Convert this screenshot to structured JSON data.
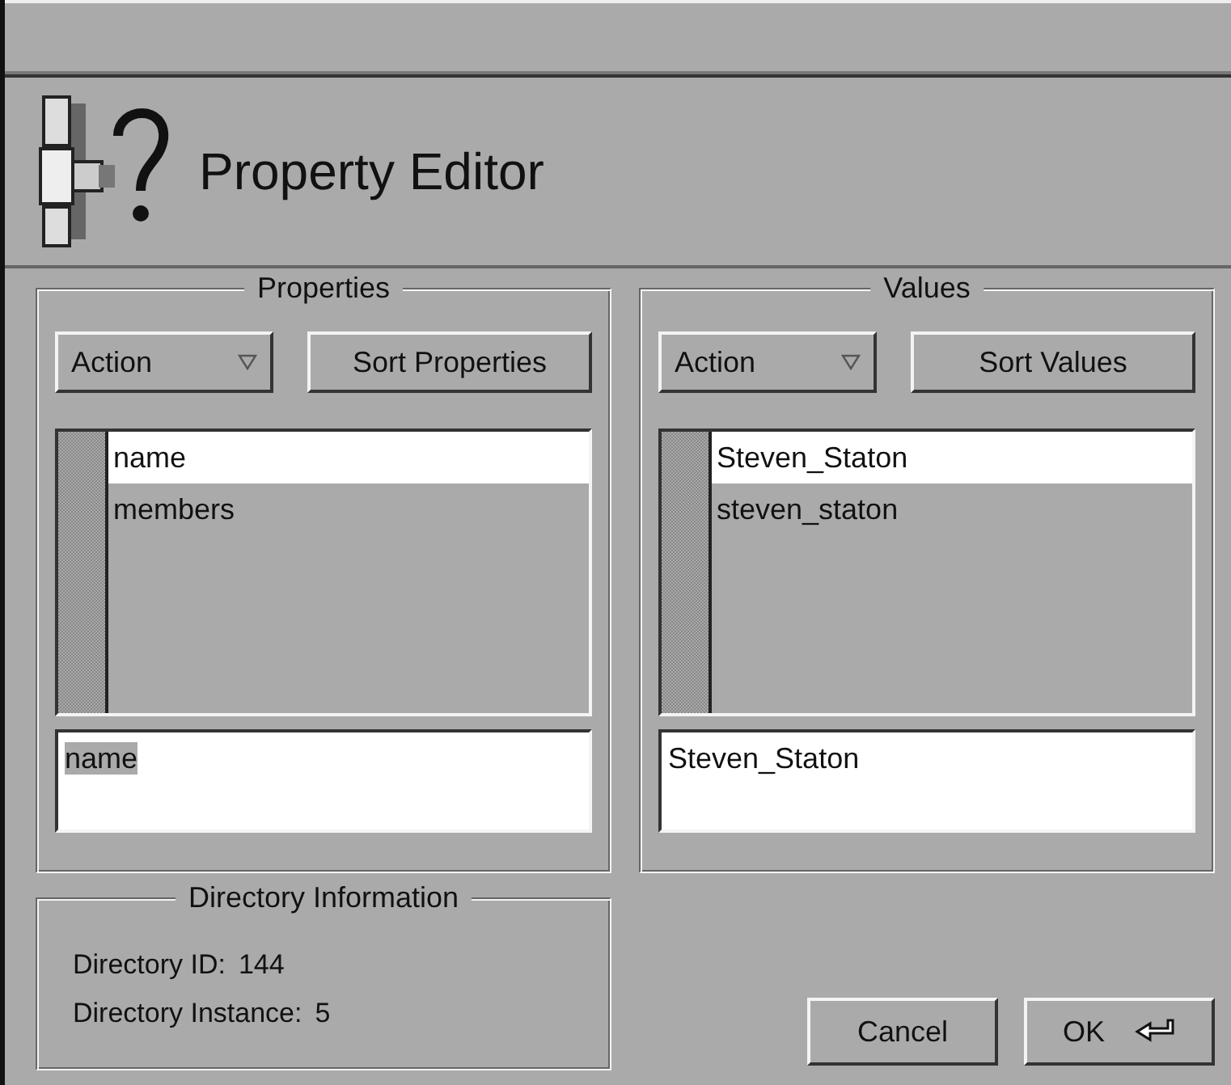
{
  "window": {
    "title": "Property Editor"
  },
  "panels": [
    {
      "title": "Properties",
      "action": {
        "label": "Action"
      },
      "sort_button": "Sort Properties",
      "items": [
        {
          "label": "name",
          "selected": true
        },
        {
          "label": "members",
          "selected": false
        }
      ],
      "field": {
        "value": "name",
        "highlighted": true
      }
    },
    {
      "title": "Values",
      "action": {
        "label": "Action"
      },
      "sort_button": "Sort Values",
      "items": [
        {
          "label": "Steven_Staton",
          "selected": true
        },
        {
          "label": "steven_staton",
          "selected": false
        }
      ],
      "field": {
        "value": "Steven_Staton",
        "highlighted": false
      }
    }
  ],
  "directory_information": {
    "title": "Directory Information",
    "rows": [
      {
        "label": "Directory ID:",
        "value": "144"
      },
      {
        "label": "Directory Instance:",
        "value": "5"
      }
    ]
  },
  "buttons": [
    {
      "kind": "cancel",
      "label": "Cancel"
    },
    {
      "kind": "ok",
      "label": "OK"
    }
  ]
}
